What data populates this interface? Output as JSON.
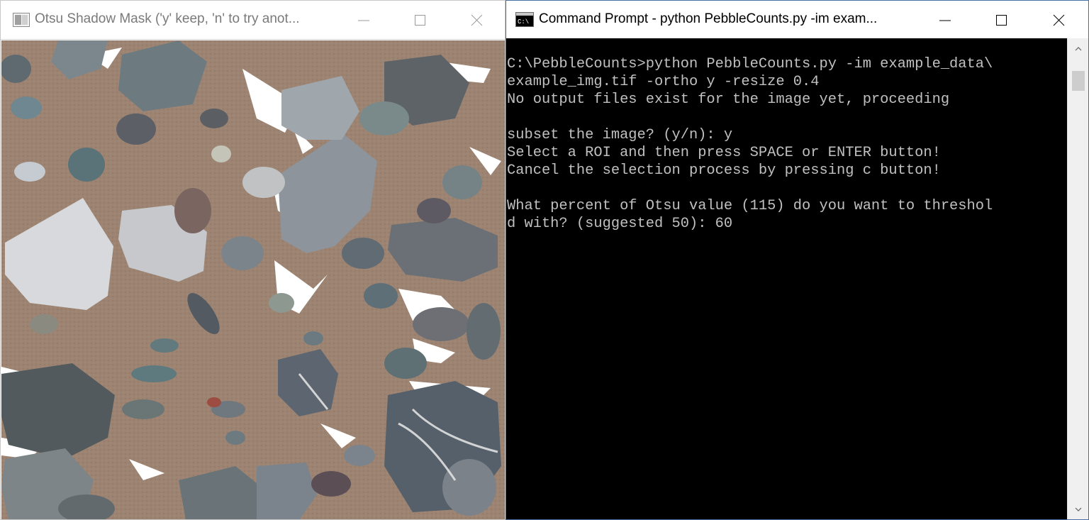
{
  "left_window": {
    "title": "Otsu Shadow Mask ('y' keep, 'n' to try anot...",
    "icon": "image-window-icon",
    "controls": [
      "minimize-icon",
      "maximize-icon",
      "close-icon"
    ],
    "content": "pebble image with white shadow mask"
  },
  "right_window": {
    "title": "Command Prompt - python  PebbleCounts.py -im exam...",
    "icon": "cmd-icon",
    "controls": [
      "minimize-icon",
      "maximize-icon",
      "close-icon"
    ],
    "console_lines": [
      "C:\\PebbleCounts>python PebbleCounts.py -im example_data\\",
      "example_img.tif -ortho y -resize 0.4",
      "No output files exist for the image yet, proceeding",
      "",
      "subset the image? (y/n): y",
      "Select a ROI and then press SPACE or ENTER button!",
      "Cancel the selection process by pressing c button!",
      "",
      "What percent of Otsu value (115) do you want to threshol",
      "d with? (suggested 50): 60"
    ],
    "scrollbar": {
      "up_icon": "scroll-up-icon",
      "down_icon": "scroll-down-icon"
    }
  },
  "colors": {
    "console_bg": "#000000",
    "console_text": "#c0c0c0",
    "sand": "#9b8270",
    "window_border": "#4a6fa5"
  }
}
